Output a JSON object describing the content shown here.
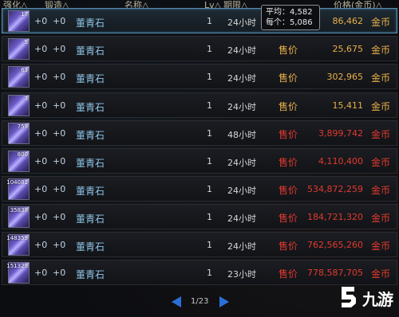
{
  "header": {
    "col_enhance": "强化△",
    "col_forge": "锻造△",
    "col_name": "名称△",
    "col_level": "Lv△",
    "col_period": "期限△",
    "col_price": "价格(金币)△"
  },
  "tooltip": {
    "avg_label": "平均：",
    "avg_value": "4,582",
    "each_label": "每个：",
    "each_value": "5,086"
  },
  "rows": [
    {
      "count": "17",
      "enhance": "+0",
      "forge": "+0",
      "name": "董青石",
      "level": "1",
      "period": "24小时",
      "sale_label": "",
      "price": "86,462",
      "unit": "金币",
      "color": "orange"
    },
    {
      "count": "5",
      "enhance": "+0",
      "forge": "+0",
      "name": "董青石",
      "level": "1",
      "period": "24小时",
      "sale_label": "售价",
      "price": "25,675",
      "unit": "金币",
      "color": "orange"
    },
    {
      "count": "63",
      "enhance": "+0",
      "forge": "+0",
      "name": "董青石",
      "level": "1",
      "period": "24小时",
      "sale_label": "售价",
      "price": "302,965",
      "unit": "金币",
      "color": "orange"
    },
    {
      "count": "3",
      "enhance": "+0",
      "forge": "+0",
      "name": "董青石",
      "level": "1",
      "period": "24小时",
      "sale_label": "售价",
      "price": "15,411",
      "unit": "金币",
      "color": "orange"
    },
    {
      "count": "759",
      "enhance": "+0",
      "forge": "+0",
      "name": "董青石",
      "level": "1",
      "period": "48小时",
      "sale_label": "售价",
      "price": "3,899,742",
      "unit": "金币",
      "color": "red"
    },
    {
      "count": "800",
      "enhance": "+0",
      "forge": "+0",
      "name": "董青石",
      "level": "1",
      "period": "24小时",
      "sale_label": "售价",
      "price": "4,110,400",
      "unit": "金币",
      "color": "red"
    },
    {
      "count": "104081",
      "enhance": "+0",
      "forge": "+0",
      "name": "董青石",
      "level": "1",
      "period": "24小时",
      "sale_label": "售价",
      "price": "534,872,259",
      "unit": "金币",
      "color": "red"
    },
    {
      "count": "35838",
      "enhance": "+0",
      "forge": "+0",
      "name": "董青石",
      "level": "1",
      "period": "24小时",
      "sale_label": "售价",
      "price": "184,721,320",
      "unit": "金币",
      "color": "red"
    },
    {
      "count": "148359",
      "enhance": "+0",
      "forge": "+0",
      "name": "董青石",
      "level": "1",
      "period": "24小时",
      "sale_label": "售价",
      "price": "762,565,260",
      "unit": "金币",
      "color": "red"
    },
    {
      "count": "151329",
      "enhance": "+0",
      "forge": "+0",
      "name": "董青石",
      "level": "1",
      "period": "23小时",
      "sale_label": "售价",
      "price": "778,587,705",
      "unit": "金币",
      "color": "red"
    }
  ],
  "pager": {
    "text": "1/23"
  },
  "logo": {
    "text": "九游"
  },
  "colors": {
    "accent": "#2a6fd8",
    "orange": "#e8b04a",
    "red": "#e23a2e",
    "name": "#8fc6ea"
  }
}
